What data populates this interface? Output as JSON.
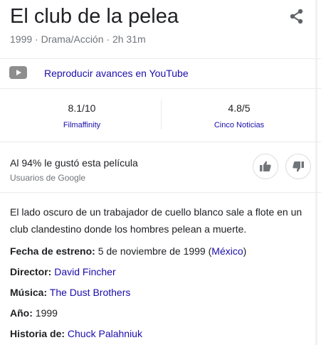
{
  "header": {
    "title": "El club de la pelea",
    "subtitle": "1999 · Drama/Acción · 2h 31m",
    "share_icon": "share-icon"
  },
  "trailer": {
    "icon": "youtube-play-icon",
    "label": "Reproducir avances en YouTube"
  },
  "ratings": [
    {
      "score": "8.1/10",
      "source": "Filmaffinity"
    },
    {
      "score": "4.8/5",
      "source": "Cinco Noticias"
    }
  ],
  "audience": {
    "liked_text": "Al 94% le gustó esta película",
    "source_text": "Usuarios de Google",
    "thumbs_up_icon": "thumbs-up-icon",
    "thumbs_down_icon": "thumbs-down-icon"
  },
  "description": "El lado oscuro de un trabajador de cuello blanco sale a flote en un club clandestino donde los hombres pelean a muerte.",
  "facts": {
    "release_label": "Fecha de estreno:",
    "release_value": "5 de noviembre de 1999 (",
    "release_country": "México",
    "release_close": ")",
    "director_label": "Director:",
    "director_value": "David Fincher",
    "music_label": "Música:",
    "music_value": "The Dust Brothers",
    "year_label": "Año:",
    "year_value": "1999",
    "story_label": "Historia de:",
    "story_value": "Chuck Palahniuk"
  },
  "colors": {
    "link": "#1a0dab",
    "secondary_text": "#70757a",
    "divider": "#ebebeb",
    "youtube_icon": "#8e8e8e"
  }
}
